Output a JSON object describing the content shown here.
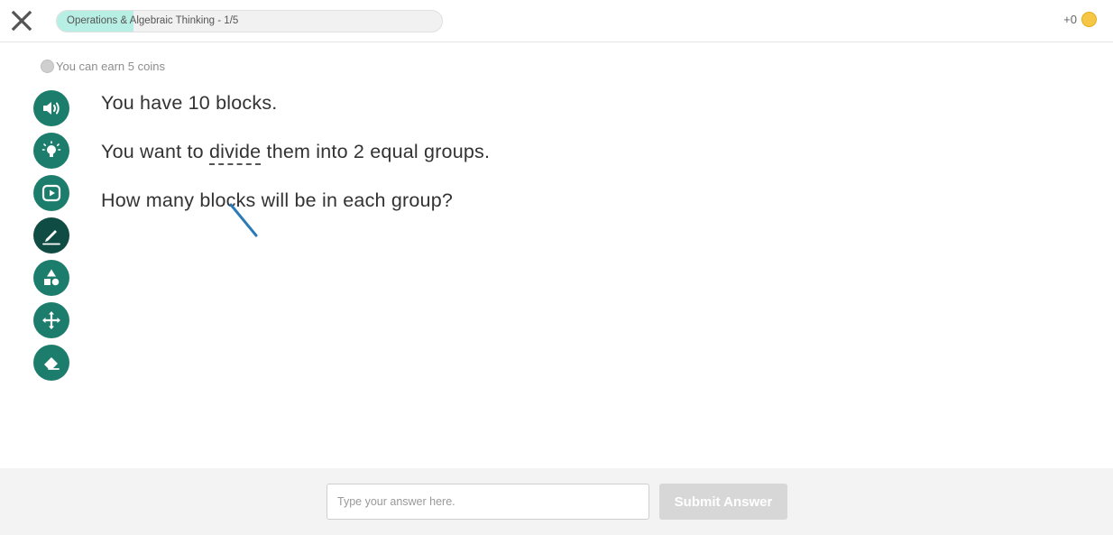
{
  "header": {
    "progress_label": "Operations & Algebraic Thinking - 1/5",
    "progress_fraction": 0.2,
    "coins_count": "+0"
  },
  "earn": {
    "text": "You can earn 5 coins"
  },
  "toolbar": {
    "tools": [
      {
        "name": "read-aloud",
        "icon": "speaker-icon"
      },
      {
        "name": "hint",
        "icon": "lightbulb-icon"
      },
      {
        "name": "video",
        "icon": "play-icon"
      },
      {
        "name": "draw",
        "icon": "pencil-icon",
        "active": true
      },
      {
        "name": "shapes",
        "icon": "shapes-icon"
      },
      {
        "name": "move",
        "icon": "move-arrows-icon"
      },
      {
        "name": "erase",
        "icon": "eraser-icon"
      }
    ]
  },
  "question": {
    "line1": "You have 10 blocks.",
    "line2_before": "You want to ",
    "line2_vocab": "divide",
    "line2_after": " them into 2 equal groups.",
    "line3": "How many blocks will be in each group?"
  },
  "answer": {
    "placeholder": "Type your answer here.",
    "submit_label": "Submit Answer"
  },
  "colors": {
    "tool_bg": "#1c7d6d",
    "tool_active_bg": "#0f4d44",
    "progress_fill": "#b8efe4",
    "coin": "#f6c744",
    "pen_stroke": "#2a7ab8"
  }
}
